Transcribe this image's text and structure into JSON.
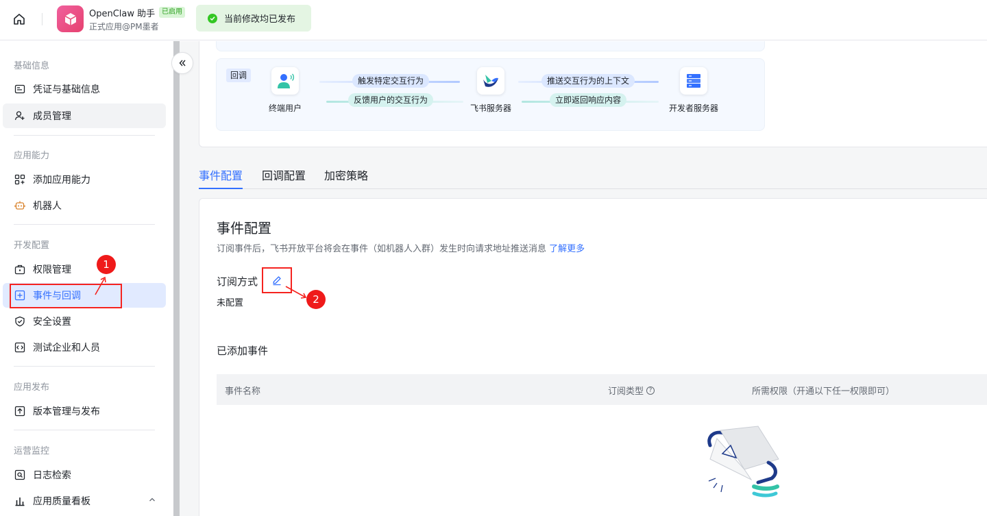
{
  "topbar": {
    "app_name": "OpenClaw 助手",
    "app_badge": "已启用",
    "app_subtitle": "正式应用@PM墨者",
    "toast": "当前修改均已发布"
  },
  "sidebar": {
    "sections": [
      {
        "title": "基础信息"
      },
      {
        "title": "应用能力"
      },
      {
        "title": "开发配置"
      },
      {
        "title": "应用发布"
      },
      {
        "title": "运营监控"
      }
    ],
    "items": {
      "credentials": "凭证与基础信息",
      "members": "成员管理",
      "add_capability": "添加应用能力",
      "bot": "机器人",
      "permissions": "权限管理",
      "events": "事件与回调",
      "security": "安全设置",
      "test_org": "测试企业和人员",
      "release": "版本管理与发布",
      "logs": "日志检索",
      "quality": "应用质量看板"
    }
  },
  "flow": {
    "tag": "回调",
    "nodes": {
      "user": "终端用户",
      "feishu": "飞书服务器",
      "developer": "开发者服务器"
    },
    "pills": {
      "trigger": "触发特定交互行为",
      "feedback": "反馈用户的交互行为",
      "push": "推送交互行为的上下文",
      "respond": "立即返回响应内容"
    },
    "colors": {
      "blue": "#3370ff",
      "green": "#34c3a7"
    }
  },
  "tabs": [
    {
      "label": "事件配置"
    },
    {
      "label": "回调配置"
    },
    {
      "label": "加密策略"
    }
  ],
  "event": {
    "title": "事件配置",
    "description": "订阅事件后，飞书开放平台将会在事件（如机器人入群）发生时向请求地址推送消息",
    "learn_more": "了解更多",
    "subscription_label": "订阅方式",
    "subscription_value": "未配置",
    "added_title": "已添加事件",
    "columns": {
      "name": "事件名称",
      "type": "订阅类型",
      "perm": "所需权限（开通以下任一权限即可）"
    }
  },
  "annotations": {
    "first": "1",
    "second": "2"
  }
}
